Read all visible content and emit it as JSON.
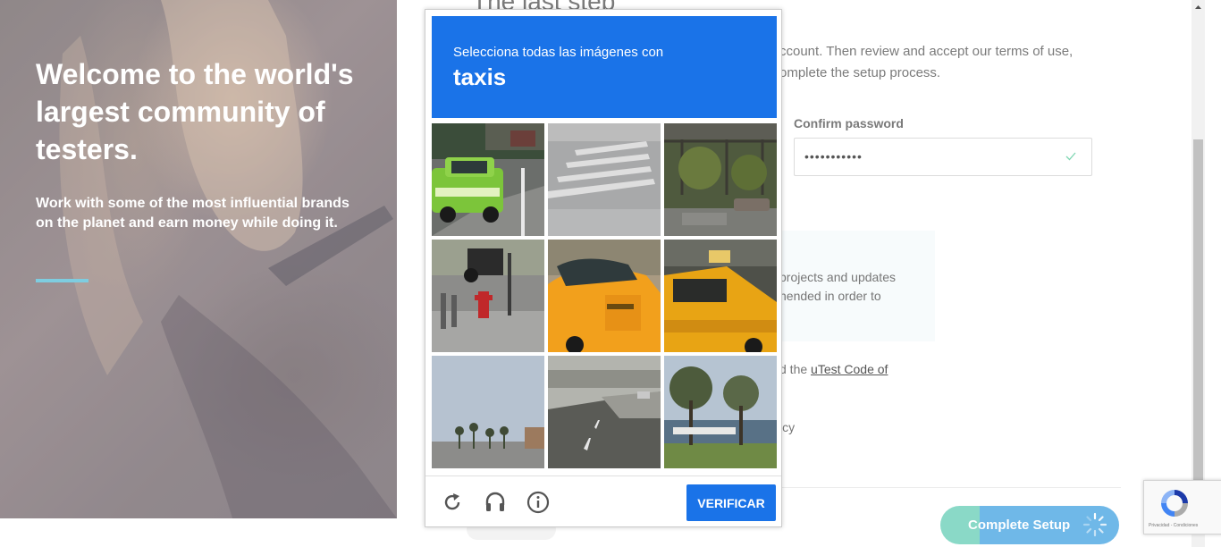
{
  "hero": {
    "title": "Welcome to the world's largest community of testers.",
    "subtitle": "Work with some of the most influential brands on the planet and earn money while doing it.",
    "accent_color": "#7ecde0"
  },
  "form": {
    "heading": "The last step",
    "intro": "ccount. Then review and accept our terms of use, omplete the setup process.",
    "confirm_password_label": "Confirm password",
    "confirm_password_value": "•••••••••••",
    "info_text": "projects and updates nended in order to",
    "code_prefix": "d the ",
    "code_link": "uTest Code of",
    "policy_fragment": "icy",
    "complete_button": "Complete Setup"
  },
  "captcha": {
    "instruction": "Selecciona todas las imágenes con",
    "target": "taxis",
    "verify_button": "VERIFICAR",
    "header_color": "#1a73e8",
    "icons": [
      "reload-icon",
      "audio-icon",
      "info-icon"
    ]
  },
  "recaptcha_badge": {
    "legal": "Privacidad - Condiciones"
  }
}
